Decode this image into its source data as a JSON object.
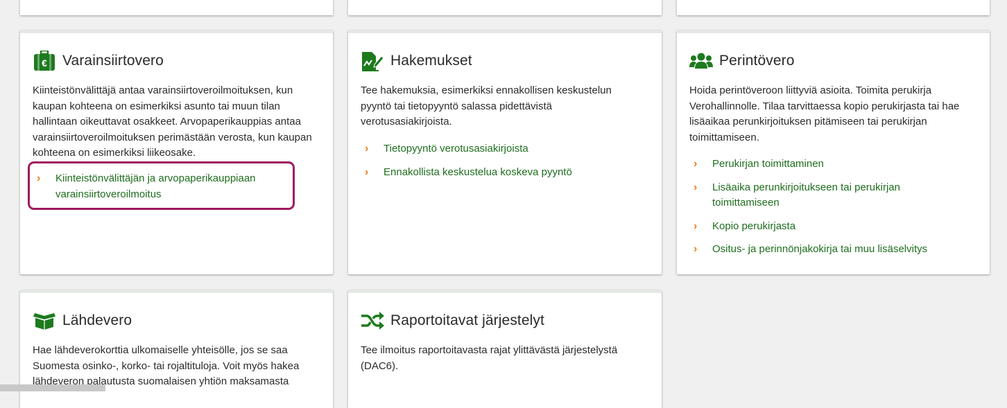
{
  "cards": {
    "varainsiirtovero": {
      "title": "Varainsiirtovero",
      "icon": "briefcase-euro-icon",
      "description": "Kiinteistönvälittäjä antaa varainsiirtoveroilmoituksen, kun kaupan kohteena on esimerkiksi asunto tai muun tilan hallintaan oikeuttavat osakkeet. Arvopaperikauppias antaa varainsiirtoveroilmoituksen perimästään verosta, kun kaupan kohteena on esimerkiksi liikeosake.",
      "links": [
        {
          "label": "Kiinteistönvälittäjän ja arvopaperikauppiaan varainsiirtoveroilmoitus"
        }
      ]
    },
    "hakemukset": {
      "title": "Hakemukset",
      "icon": "document-edit-icon",
      "description": "Tee hakemuksia, esimerkiksi ennakollisen keskustelun pyyntö tai tietopyyntö salassa pidettävistä verotusasiakirjoista.",
      "links": [
        {
          "label": "Tietopyyntö verotusasiakirjoista"
        },
        {
          "label": "Ennakollista keskustelua koskeva pyyntö"
        }
      ]
    },
    "perintovero": {
      "title": "Perintövero",
      "icon": "people-group-icon",
      "description": "Hoida perintöveroon liittyviä asioita. Toimita perukirja Verohallinnolle. Tilaa tarvittaessa kopio perukirjasta tai hae lisäaikaa perunkirjoituksen pitämiseen tai perukirjan toimittamiseen.",
      "links": [
        {
          "label": "Perukirjan toimittaminen"
        },
        {
          "label": "Lisäaika perunkirjoitukseen tai perukirjan toimittamiseen"
        },
        {
          "label": "Kopio perukirjasta"
        },
        {
          "label": "Ositus- ja perinnönjakokirja tai muu lisäselvitys"
        }
      ]
    },
    "lahdevero": {
      "title": "Lähdevero",
      "icon": "open-box-icon",
      "description": "Hae lähdeverokorttia ulkomaiselle yhteisölle, jos se saa Suomesta osinko-, korko- tai rojaltituloja. Voit myös hakea lähdeveron palautusta suomalaisen yhtiön maksamasta"
    },
    "raportoitavat": {
      "title": "Raportoitavat järjestelyt",
      "icon": "shuffle-arrows-icon",
      "description": "Tee ilmoitus raportoitavasta rajat ylittävästä järjestelystä (DAC6)."
    }
  },
  "colors": {
    "link": "#1e6e1e",
    "chevron": "#f07d19",
    "icon": "#1e7a1e",
    "highlight": "#a0185e"
  }
}
